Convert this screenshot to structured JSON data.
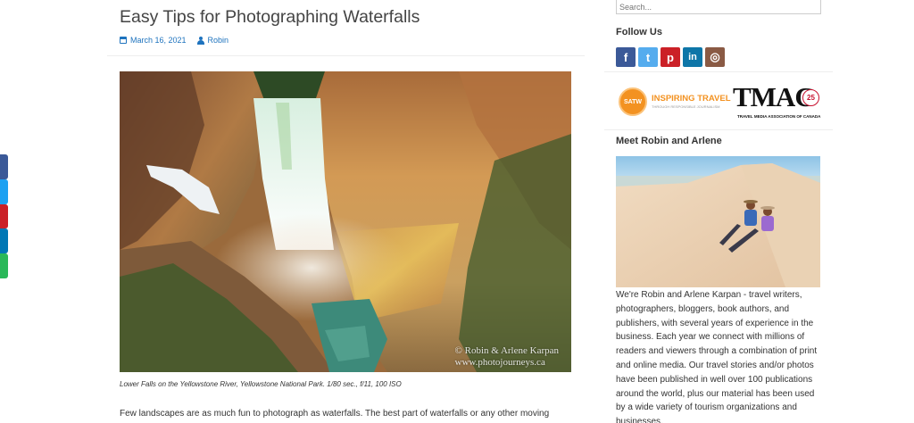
{
  "article": {
    "title": "Easy Tips for Photographing Waterfalls",
    "date": "March 16, 2021",
    "author": "Robin",
    "image": {
      "watermark_line1": "© Robin & Arlene Karpan",
      "watermark_line2": "www.photojourneys.ca",
      "caption": "Lower Falls on the Yellowstone River, Yellowstone National Park. 1/80 sec., f/11, 100 ISO"
    },
    "body": "Few landscapes are as much fun to photograph as waterfalls. The best part of waterfalls or any other moving"
  },
  "share_rail": {
    "items": [
      {
        "name": "facebook-share",
        "color": "#3b5998"
      },
      {
        "name": "twitter-share",
        "color": "#1da1f2"
      },
      {
        "name": "pinterest-share",
        "color": "#cb2027"
      },
      {
        "name": "linkedin-share",
        "color": "#0077b5"
      },
      {
        "name": "email-share",
        "color": "#2ab859"
      }
    ]
  },
  "sidebar": {
    "search": {
      "placeholder": "Search..."
    },
    "follow": {
      "title": "Follow Us",
      "icons": [
        {
          "name": "facebook-icon",
          "glyph": "f",
          "color": "#3b5998"
        },
        {
          "name": "twitter-icon",
          "glyph": "t",
          "color": "#55acee"
        },
        {
          "name": "pinterest-icon",
          "glyph": "p",
          "color": "#cb2027"
        },
        {
          "name": "linkedin-icon",
          "glyph": "in",
          "color": "#0e76a8"
        },
        {
          "name": "instagram-icon",
          "glyph": "◎",
          "color": "#8a5a44"
        }
      ]
    },
    "logos": {
      "satw_badge": "SATW",
      "satw_name": "INSPIRING TRAVEL",
      "satw_tagline": "THROUGH RESPONSIBLE JOURNALISM",
      "tmac_name": "TMAC",
      "tmac_anniversary": "25",
      "tmac_tagline": "TRAVEL MEDIA ASSOCIATION OF CANADA"
    },
    "meet": {
      "title": "Meet Robin and Arlene",
      "bio": "We're Robin and Arlene Karpan - travel writers, photographers, bloggers, book authors, and publishers, with several years of experience in the business. Each year we connect with millions of readers and viewers through a combination of print and online media. Our travel stories and/or photos have been published in well over 100 publications around the world, plus our material has been used by a wide variety of tourism organizations and businesses."
    }
  }
}
